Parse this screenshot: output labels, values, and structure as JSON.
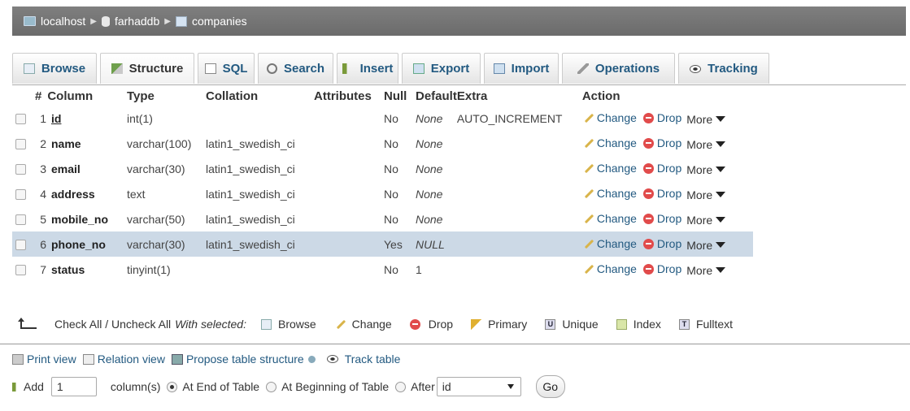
{
  "breadcrumb": {
    "server": "localhost",
    "database": "farhaddb",
    "table": "companies"
  },
  "tabs": [
    {
      "label": "Browse",
      "icon": "browse-icon"
    },
    {
      "label": "Structure",
      "icon": "structure-icon"
    },
    {
      "label": "SQL",
      "icon": "sql-icon"
    },
    {
      "label": "Search",
      "icon": "search-icon"
    },
    {
      "label": "Insert",
      "icon": "insert-icon"
    },
    {
      "label": "Export",
      "icon": "export-icon"
    },
    {
      "label": "Import",
      "icon": "import-icon"
    },
    {
      "label": "Operations",
      "icon": "operations-icon"
    },
    {
      "label": "Tracking",
      "icon": "tracking-icon"
    }
  ],
  "table": {
    "headers": {
      "num": "#",
      "column": "Column",
      "type": "Type",
      "collation": "Collation",
      "attributes": "Attributes",
      "null": "Null",
      "default": "Default",
      "extra": "Extra",
      "action": "Action"
    },
    "rows": [
      {
        "num": "1",
        "name": "id",
        "type": "int(1)",
        "collation": "",
        "attributes": "",
        "null": "No",
        "default": "None",
        "extra": "AUTO_INCREMENT"
      },
      {
        "num": "2",
        "name": "name",
        "type": "varchar(100)",
        "collation": "latin1_swedish_ci",
        "attributes": "",
        "null": "No",
        "default": "None",
        "extra": ""
      },
      {
        "num": "3",
        "name": "email",
        "type": "varchar(30)",
        "collation": "latin1_swedish_ci",
        "attributes": "",
        "null": "No",
        "default": "None",
        "extra": ""
      },
      {
        "num": "4",
        "name": "address",
        "type": "text",
        "collation": "latin1_swedish_ci",
        "attributes": "",
        "null": "No",
        "default": "None",
        "extra": ""
      },
      {
        "num": "5",
        "name": "mobile_no",
        "type": "varchar(50)",
        "collation": "latin1_swedish_ci",
        "attributes": "",
        "null": "No",
        "default": "None",
        "extra": ""
      },
      {
        "num": "6",
        "name": "phone_no",
        "type": "varchar(30)",
        "collation": "latin1_swedish_ci",
        "attributes": "",
        "null": "Yes",
        "default": "NULL",
        "extra": ""
      },
      {
        "num": "7",
        "name": "status",
        "type": "tinyint(1)",
        "collation": "",
        "attributes": "",
        "null": "No",
        "default": "1",
        "extra": ""
      }
    ],
    "action_labels": {
      "change": "Change",
      "drop": "Drop",
      "more": "More"
    }
  },
  "with_selected": {
    "check_all": "Check All / Uncheck All",
    "with_selected": "With selected:",
    "buttons": [
      "Browse",
      "Change",
      "Drop",
      "Primary",
      "Unique",
      "Index",
      "Fulltext"
    ]
  },
  "links": {
    "print_view": "Print view",
    "relation_view": "Relation view",
    "propose": "Propose table structure",
    "track": "Track table"
  },
  "add_column": {
    "add_label": "Add",
    "count": "1",
    "columns_label": "column(s)",
    "at_end": "At End of Table",
    "at_beginning": "At Beginning of Table",
    "after": "After",
    "after_value": "id",
    "go": "Go"
  },
  "colors": {
    "link": "#235a81",
    "highlight_row": "#ccd9e6",
    "crumb_bg": "#737373",
    "drop": "#e14b4b"
  }
}
